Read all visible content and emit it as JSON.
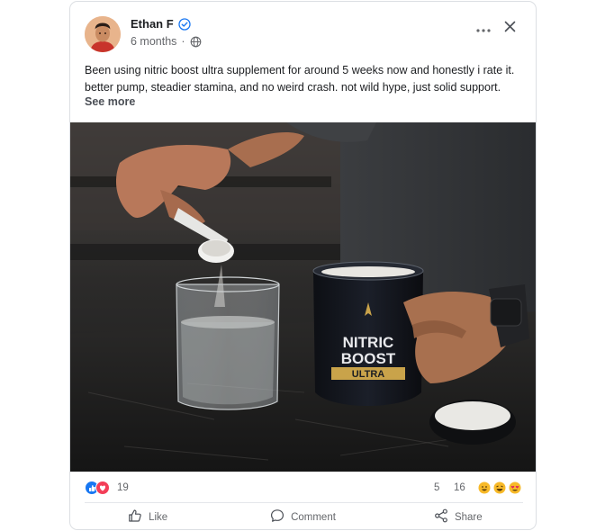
{
  "post": {
    "author": "Ethan F",
    "time": "6 months",
    "separator": "·",
    "body": "Been using nitric boost ultra supplement for around 5 weeks now and honestly i rate it. better pump, steadier stamina, and no weird crash. not wild hype, just solid support.",
    "see_more": "See more",
    "photo": {
      "product_line1": "NITRIC",
      "product_line2": "BOOST",
      "product_line3": "ULTRA"
    }
  },
  "stats": {
    "reactions": "19",
    "comments": "5",
    "shares": "16"
  },
  "actions": {
    "like": "Like",
    "comment": "Comment",
    "share": "Share"
  },
  "icons": {
    "verified": "verified-badge-icon",
    "privacy": "globe-icon",
    "more": "more-horizontal-icon",
    "close": "close-icon"
  },
  "colors": {
    "accent": "#1877f2",
    "text_muted": "#65676b",
    "love": "#f33e58",
    "product_gold": "#c9a34a"
  }
}
